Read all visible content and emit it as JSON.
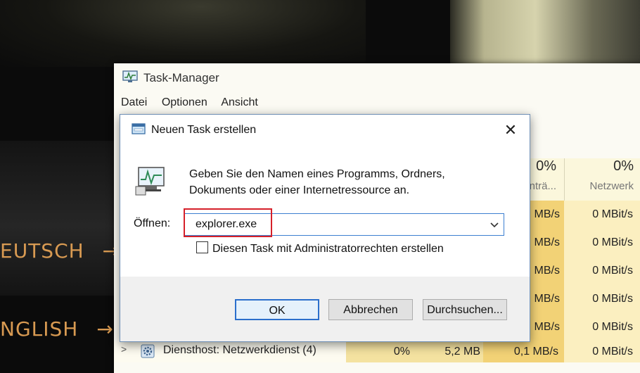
{
  "background": {
    "lang_items": [
      {
        "label": "EUTSCH",
        "arrow": "→"
      },
      {
        "label": "NGLISH",
        "arrow": "→"
      }
    ]
  },
  "task_manager": {
    "title": "Task-Manager",
    "menu": [
      "Datei",
      "Optionen",
      "Ansicht"
    ],
    "columns": {
      "disk": {
        "percent": "0%",
        "name": "nträ..."
      },
      "network": {
        "percent": "0%",
        "name": "Netzwerk"
      }
    },
    "rows": [
      {
        "disk": "MB/s",
        "net": "0 MBit/s"
      },
      {
        "disk": "MB/s",
        "net": "0 MBit/s"
      },
      {
        "disk": "MB/s",
        "net": "0 MBit/s"
      },
      {
        "disk": "MB/s",
        "net": "0 MBit/s"
      },
      {
        "disk": "MB/s",
        "net": "0 MBit/s"
      }
    ],
    "last_row": {
      "expander": ">",
      "name": "Diensthost: Netzwerkdienst (4)",
      "cpu": "0%",
      "memory": "5,2 MB",
      "disk": "0,1 MB/s",
      "network": "0 MBit/s"
    }
  },
  "dialog": {
    "title": "Neuen Task erstellen",
    "close": "✕",
    "description": "Geben Sie den Namen eines Programms, Ordners, Dokuments oder einer Internetressource an.",
    "open_label": "Öffnen:",
    "open_value": "explorer.exe",
    "admin_checkbox_label": "Diesen Task mit Administratorrechten erstellen",
    "admin_checked": false,
    "buttons": {
      "ok": "OK",
      "cancel": "Abbrechen",
      "browse": "Durchsuchen..."
    }
  },
  "colors": {
    "highlight": "#d6202a",
    "accent": "#2b6fcc",
    "heat_strong": "#f2d276",
    "heat_light": "#fbefc0"
  }
}
